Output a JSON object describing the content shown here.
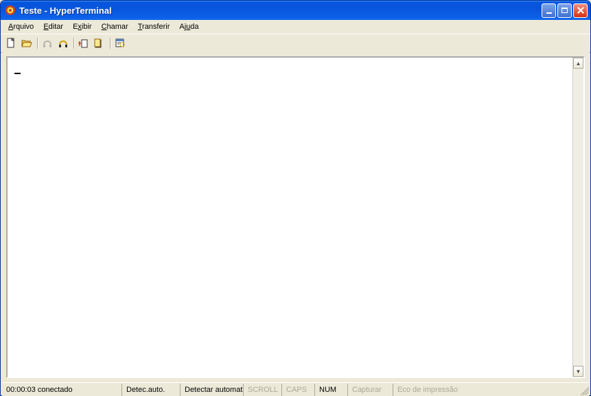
{
  "window": {
    "title": "Teste - HyperTerminal"
  },
  "menu": {
    "items": [
      {
        "label": "Arquivo",
        "accel": "A"
      },
      {
        "label": "Editar",
        "accel": "E"
      },
      {
        "label": "Exibir",
        "accel": "E"
      },
      {
        "label": "Chamar",
        "accel": "C"
      },
      {
        "label": "Transferir",
        "accel": "T"
      },
      {
        "label": "Ajuda",
        "accel": "A"
      }
    ]
  },
  "toolbar": {
    "buttons": [
      {
        "name": "new-icon"
      },
      {
        "name": "open-icon"
      },
      {
        "name": "connect-icon",
        "disabled": true
      },
      {
        "name": "disconnect-icon"
      },
      {
        "name": "send-icon"
      },
      {
        "name": "receive-icon"
      },
      {
        "name": "properties-icon"
      }
    ]
  },
  "terminal": {
    "content": ""
  },
  "status": {
    "connection": "00:00:03 conectado",
    "detect": "Detec.auto.",
    "setting": "Detectar automat",
    "scroll": "SCROLL",
    "caps": "CAPS",
    "num": "NUM",
    "capture": "Capturar",
    "echo": "Eco de impressão"
  }
}
